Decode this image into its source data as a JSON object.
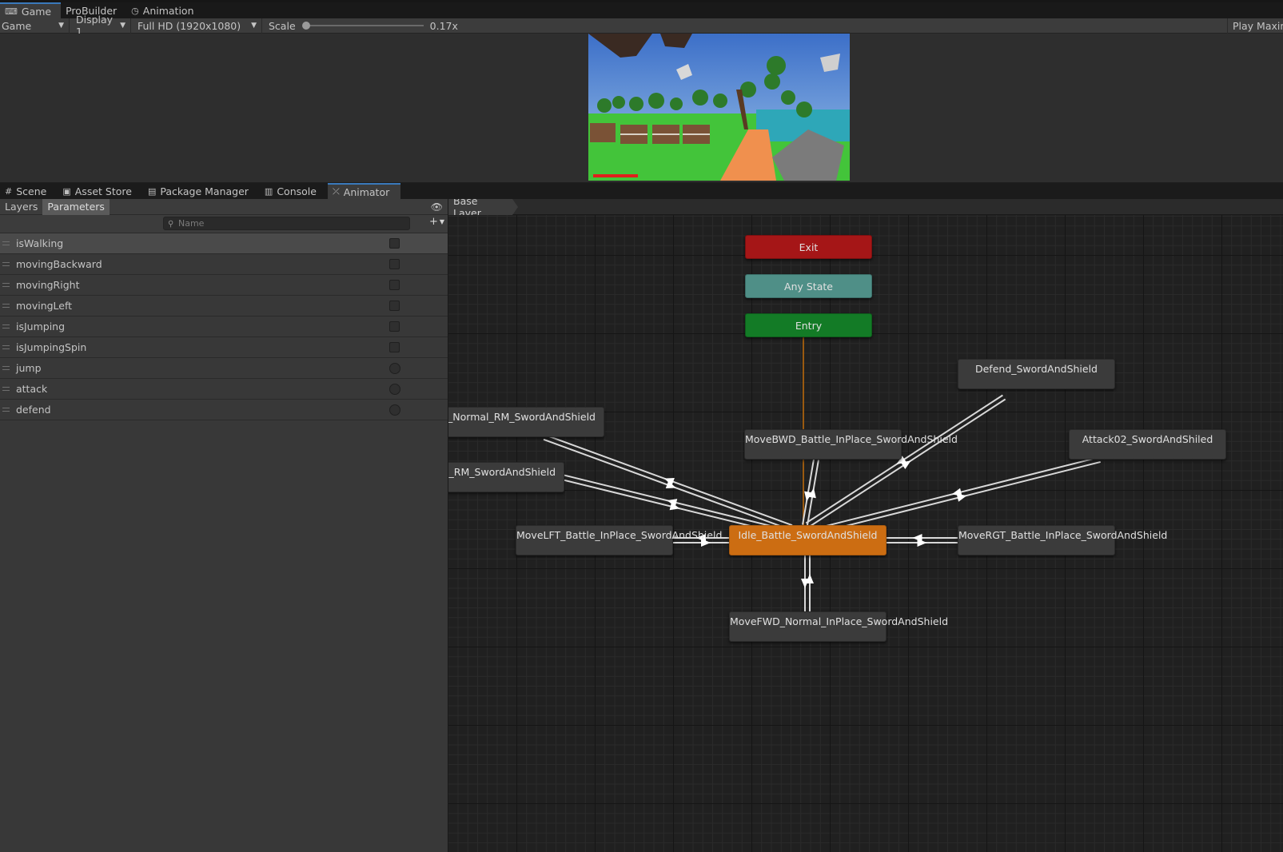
{
  "top_tabs": [
    {
      "label": "Game",
      "icon": "gamepad-icon",
      "glyph": "⌨",
      "active": true
    },
    {
      "label": "ProBuilder",
      "icon": "",
      "glyph": "",
      "active": false
    },
    {
      "label": "Animation",
      "icon": "clock-icon",
      "glyph": "◷",
      "active": false
    }
  ],
  "game_toolbar": {
    "view_dropdown": "Game",
    "display_dropdown": "Display 1",
    "resolution_dropdown": "Full HD (1920x1080)",
    "scale_label": "Scale",
    "scale_value": "0.17x",
    "scale_fraction": 0.0,
    "play_mode": "Play Maximi"
  },
  "bottom_tabs": [
    {
      "label": "Scene",
      "icon": "grid-icon",
      "glyph": "#",
      "active": false
    },
    {
      "label": "Asset Store",
      "icon": "bag-icon",
      "glyph": "▣",
      "active": false
    },
    {
      "label": "Package Manager",
      "icon": "package-icon",
      "glyph": "▤",
      "active": false
    },
    {
      "label": "Console",
      "icon": "console-icon",
      "glyph": "▥",
      "active": false
    },
    {
      "label": "Animator",
      "icon": "animator-icon",
      "glyph": "⤫",
      "active": true
    }
  ],
  "animator": {
    "left_tabs": {
      "layers": "Layers",
      "parameters": "Parameters"
    },
    "search_placeholder": "Name",
    "add_label": "+",
    "breadcrumb": "Base Layer",
    "parameters": [
      {
        "name": "isWalking",
        "type": "bool"
      },
      {
        "name": "movingBackward",
        "type": "bool"
      },
      {
        "name": "movingRight",
        "type": "bool"
      },
      {
        "name": "movingLeft",
        "type": "bool"
      },
      {
        "name": "isJumping",
        "type": "bool"
      },
      {
        "name": "isJumpingSpin",
        "type": "bool"
      },
      {
        "name": "jump",
        "type": "trigger"
      },
      {
        "name": "attack",
        "type": "trigger"
      },
      {
        "name": "defend",
        "type": "trigger"
      }
    ],
    "states": {
      "exit": "Exit",
      "any_state": "Any State",
      "entry": "Entry",
      "idle": "Idle_Battle_SwordAndShield",
      "defend": "Defend_SwordAndShield",
      "attack": "Attack02_SwordAndShiled",
      "move_bwd": "MoveBWD_Battle_InPlace_SwordAndShield",
      "move_lft": "MoveLFT_Battle_InPlace_SwordAndShield",
      "move_rgt": "MoveRGT_Battle_InPlace_SwordAndShield",
      "move_fwd": "MoveFWD_Normal_InPlace_SwordAndShield",
      "jump_full": "oFull_Normal_RM_SwordAndShield",
      "jump_spin": "pin_RM_SwordAndShield"
    },
    "colors": {
      "exit": "#a51617",
      "any_state": "#4f8f87",
      "entry": "#137b26",
      "default_state": "#cc6d12",
      "state": "#3b3b3b"
    }
  }
}
